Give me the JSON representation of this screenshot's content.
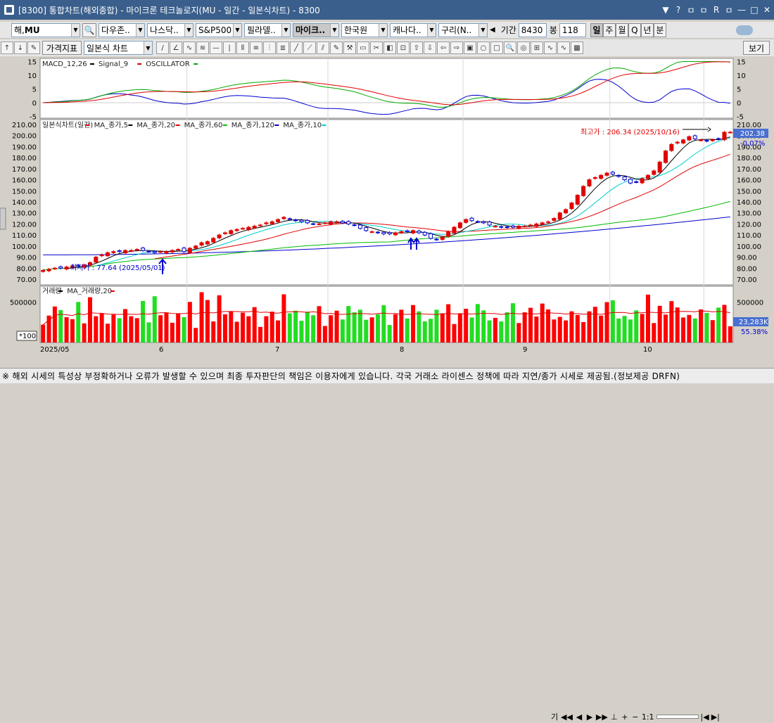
{
  "window": {
    "title": "[8300]  통합차트(해외종합) - 마이크론 테크놀로지(MU - 일간 - 일본식차트) - 8300",
    "controls": [
      "▼",
      "?",
      "ㅁ",
      "ㅁ",
      "R",
      "ㅁ",
      "—",
      "□",
      "✕"
    ]
  },
  "toolbar1": {
    "market": "해",
    "symbol": "MU",
    "indices": [
      "다우존..",
      "나스닥..",
      "S&P500",
      "필라델..",
      "마이크..",
      "한국원",
      "캐나다..",
      "구리(N.."
    ],
    "period_label": "기간",
    "period": "8430",
    "count_label": "봉",
    "count": "118",
    "timeframes": [
      "일",
      "주",
      "월",
      "Q",
      "년",
      "분"
    ],
    "active_timeframe": "일"
  },
  "toolbar2": {
    "indicator_label": "가격지표",
    "chart_type": "일본식 차트",
    "view_label": "보기"
  },
  "macd": {
    "legend": [
      {
        "text": "MACD_12,26",
        "color": "#000000"
      },
      {
        "text": "Signal_9",
        "color": "#e00000"
      },
      {
        "text": "OSCILLATOR",
        "color": "#00aa00"
      }
    ],
    "ticks": [
      "15",
      "10",
      "5",
      "0",
      "-5"
    ]
  },
  "price": {
    "legend": [
      {
        "text": "일본식차트(일간)",
        "color": "#e00000"
      },
      {
        "text": "MA_종가,5",
        "color": "#000000"
      },
      {
        "text": "MA_종가,20",
        "color": "#e00000"
      },
      {
        "text": "MA_종가,60",
        "color": "#00bb00"
      },
      {
        "text": "MA_종가,120",
        "color": "#0000cc"
      },
      {
        "text": "MA_종가,10",
        "color": "#00cccc"
      }
    ],
    "ticks": [
      "210.00",
      "200.00",
      "190.00",
      "180.00",
      "170.00",
      "160.00",
      "150.00",
      "140.00",
      "130.00",
      "120.00",
      "110.00",
      "100.00",
      "90.00",
      "80.00",
      "70.00"
    ],
    "current": "202.38",
    "change": "-0.07%",
    "high_label": "최고가 : 206.34 (2025/10/16)",
    "low_label": "최저가 : 77.64 (2025/05/01)"
  },
  "volume": {
    "legend": [
      {
        "text": "거래량",
        "color": "#000000"
      },
      {
        "text": "MA_거래량,20",
        "color": "#e00000"
      }
    ],
    "tick": "500000",
    "multiplier": "*100",
    "current": "23,283K",
    "pct": "55.38%"
  },
  "xaxis": [
    "2025/05",
    "6",
    "7",
    "8",
    "9",
    "10"
  ],
  "nav": {
    "zoom": "1:1",
    "label": "기"
  },
  "status": "※ 해외 시세의 특성상 부정확하거나 오류가 발생할 수 있으며 최종 투자판단의 책임은 이용자에게 있습니다. 각국 거래소 라이센스 정책에 따라 지연/종가 시세로 제공됨.(정보제공 DRFN)",
  "chart_data": {
    "type": "candlestick",
    "title": "",
    "x": [
      "2025/05",
      "6",
      "7",
      "8",
      "9",
      "10"
    ],
    "ylim": [
      70,
      210
    ],
    "high": 206.34,
    "high_date": "2025/10/16",
    "low": 77.64,
    "low_date": "2025/05/01",
    "last": 202.38,
    "change_pct": -0.07,
    "closes": [
      78,
      79,
      80,
      80,
      81,
      82,
      82,
      83,
      85,
      90,
      92,
      94,
      95,
      95,
      96,
      96,
      97,
      96,
      95,
      94,
      95,
      95,
      96,
      97,
      95,
      98,
      100,
      103,
      104,
      107,
      110,
      112,
      114,
      115,
      116,
      117,
      118,
      119,
      121,
      122,
      124,
      126,
      124,
      123,
      122,
      121,
      120,
      120,
      121,
      122,
      122,
      121,
      120,
      119,
      116,
      114,
      113,
      112,
      111,
      111,
      112,
      113,
      113,
      114,
      112,
      110,
      107,
      106,
      108,
      113,
      117,
      121,
      124,
      123,
      122,
      121,
      119,
      118,
      117,
      117,
      117,
      118,
      118,
      119,
      120,
      121,
      122,
      125,
      130,
      133,
      139,
      146,
      154,
      160,
      162,
      164,
      166,
      165,
      163,
      160,
      157,
      158,
      161,
      164,
      168,
      176,
      186,
      192,
      194,
      196,
      199,
      197,
      196,
      195,
      196,
      197,
      203,
      203
    ]
  }
}
